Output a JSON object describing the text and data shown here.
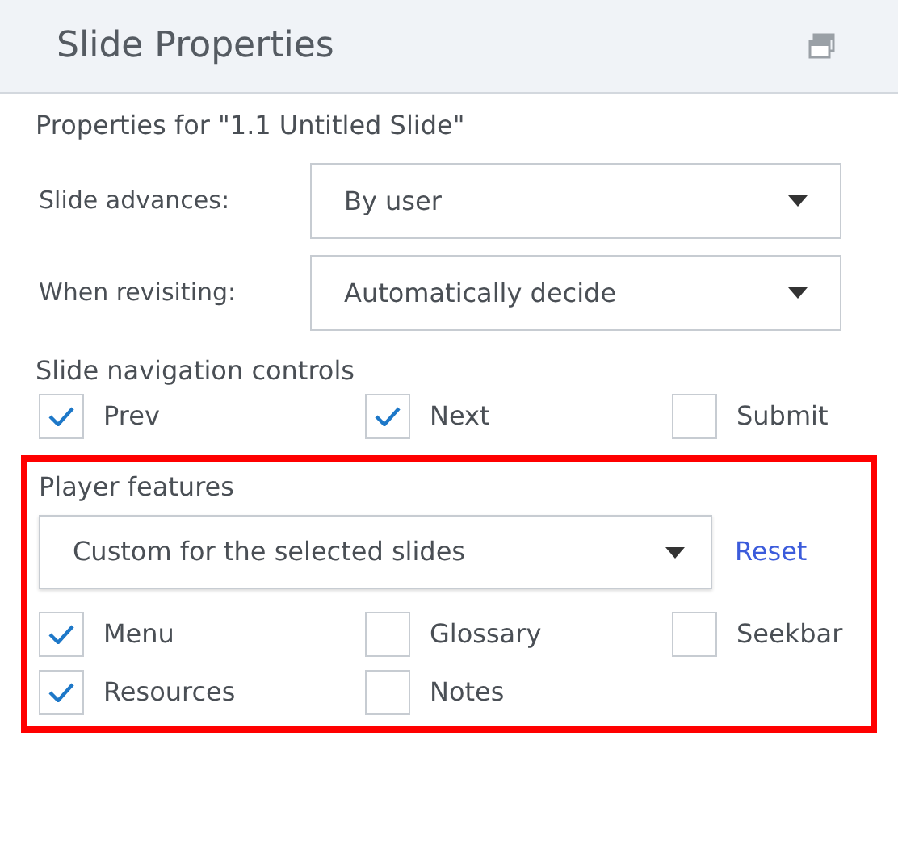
{
  "panel": {
    "title": "Slide Properties"
  },
  "properties_heading": "Properties for \"1.1 Untitled Slide\"",
  "fields": [
    {
      "label": "Slide advances:",
      "value": "By user"
    },
    {
      "label": "When revisiting:",
      "value": "Automatically decide"
    }
  ],
  "navigation": {
    "heading": "Slide navigation controls",
    "options": [
      {
        "label": "Prev",
        "checked": true
      },
      {
        "label": "Next",
        "checked": true
      },
      {
        "label": "Submit",
        "checked": false
      }
    ]
  },
  "player_features": {
    "heading": "Player features",
    "value": "Custom for the selected slides",
    "reset": "Reset",
    "options": [
      {
        "label": "Menu",
        "checked": true
      },
      {
        "label": "Glossary",
        "checked": false
      },
      {
        "label": "Seekbar",
        "checked": false
      },
      {
        "label": "Resources",
        "checked": true
      },
      {
        "label": "Notes",
        "checked": false
      }
    ]
  }
}
